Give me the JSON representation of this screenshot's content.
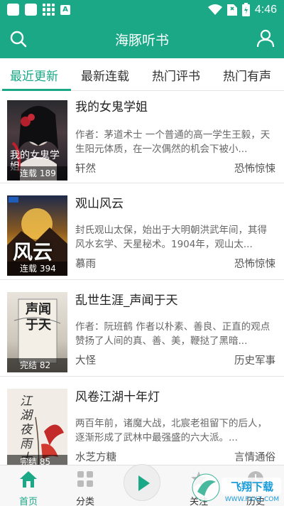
{
  "status_bar": {
    "time": "4:46",
    "a_badge": "A",
    "icons": [
      "notification-square-icon",
      "notification-square-icon",
      "grid-icon",
      "a-badge-icon",
      "wifi-icon",
      "no-sim-icon",
      "battery-charging-icon"
    ]
  },
  "app_bar": {
    "title": "海豚听书",
    "left_icon": "search-icon",
    "right_icon": "user-icon"
  },
  "tabs": [
    {
      "label": "最近更新",
      "active": true
    },
    {
      "label": "最新连载",
      "active": false
    },
    {
      "label": "热门评书",
      "active": false
    },
    {
      "label": "热门有声",
      "active": false
    }
  ],
  "books": [
    {
      "title": "我的女鬼学姐",
      "description": "作者：茅道术士 一个普通的高一学生王毅，天生阳元体质，在一次偶然的机会下被小...",
      "author": "轩然",
      "category": "恐怖惊悚",
      "badge": "连载 189",
      "cover_text": "我的女鬼学姐"
    },
    {
      "title": "观山风云",
      "description": "封氏观山太保，始出于大明朝洪武年间，其得风水玄学、天星秘术。1904年，观山太...",
      "author": "慕雨",
      "category": "恐怖惊悚",
      "badge": "连载 394",
      "cover_text": "风云"
    },
    {
      "title": "乱世生涯_声闻于天",
      "description": "作者：阮班鹤 作者以朴素、善良、正直的观点赞扬了人间的真、善、美，鞭挞了黑暗...",
      "author": "大怪",
      "category": "历史军事",
      "badge": "完结 82",
      "cover_text": "声闻于天"
    },
    {
      "title": "风卷江湖十年灯",
      "description": "两百年前，诸魔大战，北宸老祖留下的后人，逐渐形成了武林中最强盛的六大派。...",
      "author": "水芝方糖",
      "category": "言情通俗",
      "badge": "完结 85",
      "cover_text": "江湖夜雨十年灯"
    }
  ],
  "bottom_nav": [
    {
      "label": "首页",
      "icon": "home-icon",
      "active": true
    },
    {
      "label": "分类",
      "icon": "category-icon",
      "active": false
    },
    {
      "label": "",
      "icon": "play-icon",
      "active": false
    },
    {
      "label": "关注",
      "icon": "star-icon",
      "active": false
    },
    {
      "label": "历史",
      "icon": "history-icon",
      "active": false
    }
  ],
  "watermark": {
    "text": "飞翔下载",
    "url_text": "WWW.FXXZ.COM"
  },
  "colors": {
    "primary": "#1aa886",
    "text": "#222222",
    "muted": "#666666",
    "divider": "#e3e3e3"
  }
}
